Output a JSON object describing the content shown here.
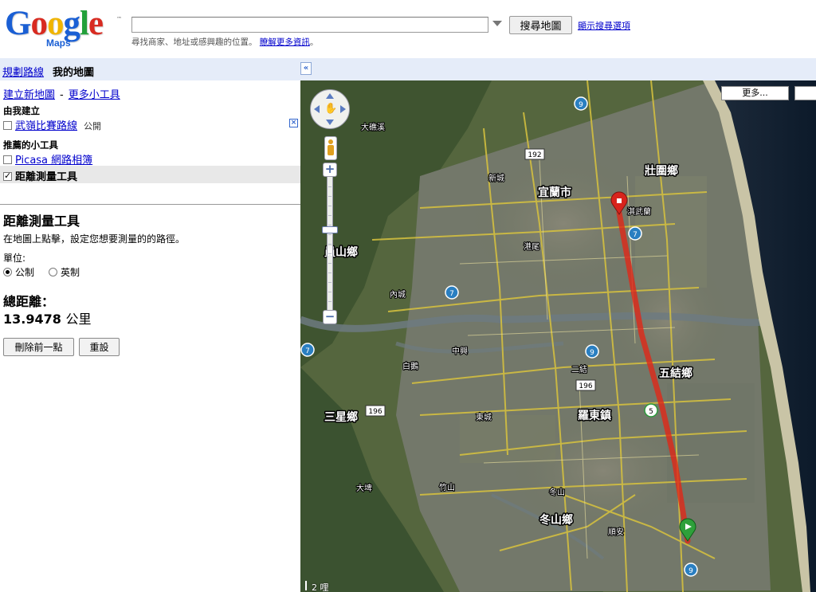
{
  "header": {
    "logo_text": "Google",
    "logo_sub": "Maps",
    "search": {
      "value": "",
      "placeholder": ""
    },
    "search_button": "搜尋地圖",
    "show_options": "顯示搜尋選項",
    "hint_text": "尋找商家、地址或感興趣的位置。",
    "hint_link": "瞭解更多資訊"
  },
  "tabs": {
    "directions": "規劃路線",
    "my_maps": "我的地圖"
  },
  "panel": {
    "new_map": "建立新地圖",
    "more_tools": "更多小工具",
    "created_by_me": "由我建立",
    "my_map": {
      "name": "武嶺比賽路線",
      "visibility": "公開",
      "checked": false
    },
    "featured_h": "推薦的小工具",
    "picasa": {
      "label": "Picasa 網路相簿",
      "checked": false
    },
    "distance_tool": {
      "label": "距離測量工具",
      "checked": true
    },
    "tool_title": "距離測量工具",
    "tool_desc": "在地圖上點擊，設定您想要測量的的路徑。",
    "units_label": "單位:",
    "units": [
      {
        "label": "公制",
        "selected": true
      },
      {
        "label": "英制",
        "selected": false
      }
    ],
    "total_label": "總距離：",
    "total_value": "13.9478",
    "total_unit": "公里",
    "undo_button": "刪除前一點",
    "reset_button": "重設"
  },
  "map": {
    "more_button": "更多...",
    "scale": "2 哩",
    "route_color": "#e02818",
    "start_marker_color": "#d8241c",
    "end_marker_color": "#2ea03a",
    "labels": {
      "yilan_city": "宜蘭市",
      "zhuangwei": "壯圍鄉",
      "wujie": "五結鄉",
      "luodong": "羅東鎮",
      "sanxing": "三星鄉",
      "dongshan": "冬山鄉",
      "yuanshan": "員山鄉",
      "datong": "大礁溪",
      "xinyi": "新城",
      "huxi": "內城",
      "zhongxing": "中興",
      "gangzi": "港尾",
      "erjie": "二結",
      "baiya": "白鵝",
      "zhushan": "竹山",
      "dapi": "大埤",
      "dongcheng": "東城",
      "qufu": "淇武蘭",
      "shunan": "順安",
      "dongshan_ji": "冬山"
    },
    "roads": {
      "r192": "192",
      "r196": "196",
      "r9": "9",
      "r7": "7",
      "r5": "5"
    }
  }
}
